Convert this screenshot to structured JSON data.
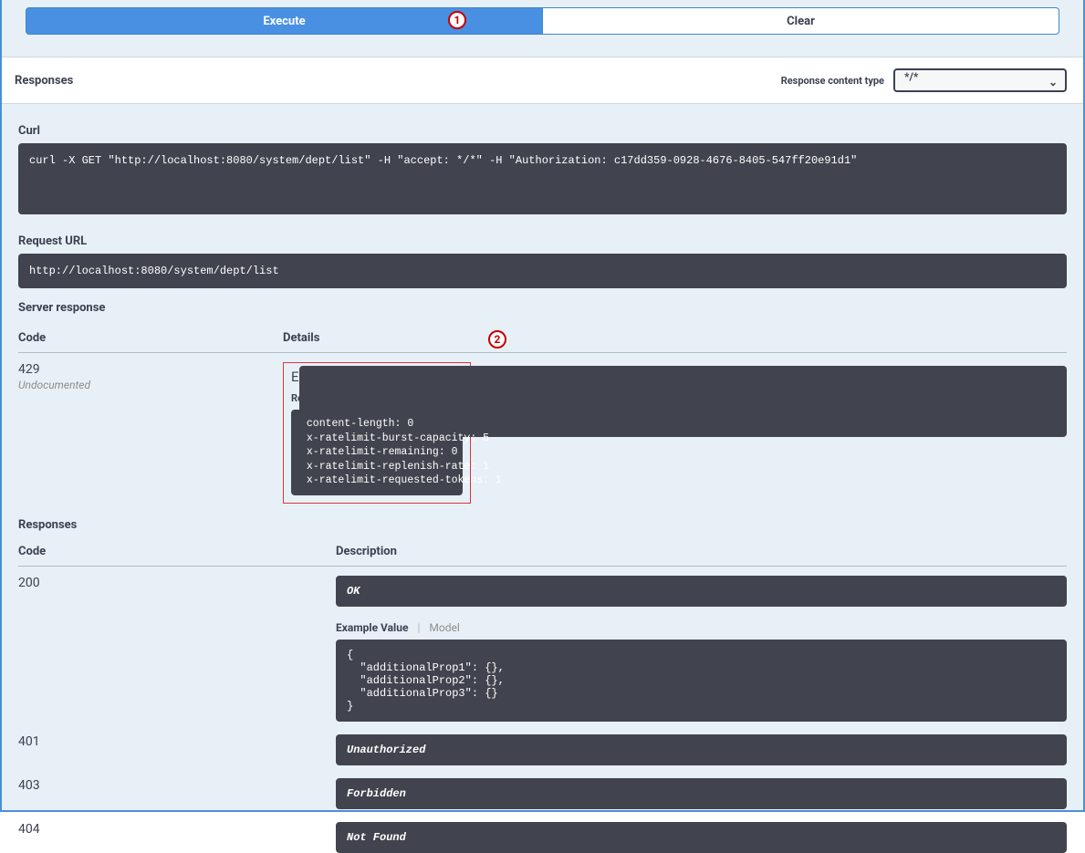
{
  "buttons": {
    "execute": "Execute",
    "clear": "Clear"
  },
  "responsesHeader": {
    "title": "Responses",
    "contentTypeLabel": "Response content type",
    "contentTypeValue": "*/*"
  },
  "curl": {
    "label": "Curl",
    "command": "curl -X GET \"http://localhost:8080/system/dept/list\" -H \"accept: */*\" -H \"Authorization: c17dd359-0928-4676-8405-547ff20e91d1\""
  },
  "requestUrl": {
    "label": "Request URL",
    "value": "http://localhost:8080/system/dept/list"
  },
  "serverResponse": {
    "label": "Server response",
    "codeHeader": "Code",
    "detailsHeader": "Details",
    "code": "429",
    "undocumented": "Undocumented",
    "errorTitle": "Error: Too Many Requests",
    "responseHeadersLabel": "Response headers",
    "headersText": " content-length: 0\n x-ratelimit-burst-capacity: 5\n x-ratelimit-remaining: 0\n x-ratelimit-replenish-rate: 1\n x-ratelimit-requested-tokens: 1"
  },
  "responsesTable": {
    "label": "Responses",
    "codeHeader": "Code",
    "descHeader": "Description",
    "rows": [
      {
        "code": "200",
        "desc": "OK",
        "exampleTabs": {
          "active": "Example Value",
          "inactive": "Model"
        },
        "example": "{\n  \"additionalProp1\": {},\n  \"additionalProp2\": {},\n  \"additionalProp3\": {}\n}"
      },
      {
        "code": "401",
        "desc": "Unauthorized"
      },
      {
        "code": "403",
        "desc": "Forbidden"
      },
      {
        "code": "404",
        "desc": "Not Found"
      }
    ]
  },
  "callouts": {
    "one": "1",
    "two": "2"
  }
}
